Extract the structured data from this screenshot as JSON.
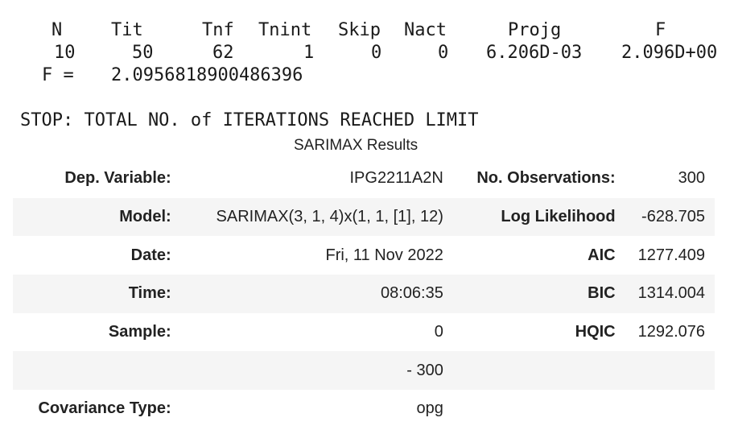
{
  "optimizer": {
    "headers": [
      "N",
      "Tit",
      "Tnf",
      "Tnint",
      "Skip",
      "Nact",
      "Projg",
      "F"
    ],
    "values": [
      "10",
      "50",
      "62",
      "1",
      "0",
      "0",
      "6.206D-03",
      "2.096D+00"
    ],
    "f_label": "F =",
    "f_value": "2.0956818900486396",
    "stop_message": "STOP: TOTAL NO. of ITERATIONS REACHED LIMIT"
  },
  "results": {
    "caption": "SARIMAX Results",
    "rows": [
      {
        "label1": "Dep. Variable:",
        "value1": "IPG2211A2N",
        "label2": "No. Observations:",
        "value2": "300"
      },
      {
        "label1": "Model:",
        "value1": "SARIMAX(3, 1, 4)x(1, 1, [1], 12)",
        "label2": "Log Likelihood",
        "value2": "-628.705"
      },
      {
        "label1": "Date:",
        "value1": "Fri, 11 Nov 2022",
        "label2": "AIC",
        "value2": "1277.409"
      },
      {
        "label1": "Time:",
        "value1": "08:06:35",
        "label2": "BIC",
        "value2": "1314.004"
      },
      {
        "label1": "Sample:",
        "value1": "0",
        "label2": "HQIC",
        "value2": "1292.076"
      },
      {
        "label1": "",
        "value1": "- 300",
        "label2": "",
        "value2": ""
      },
      {
        "label1": "Covariance Type:",
        "value1": "opg",
        "label2": "",
        "value2": ""
      }
    ]
  }
}
